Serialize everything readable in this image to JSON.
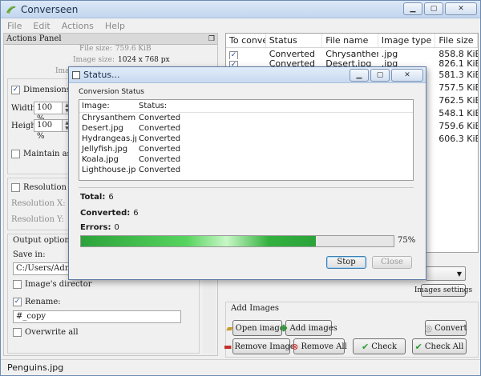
{
  "app": {
    "title": "Converseen",
    "menu": [
      "File",
      "Edit",
      "Actions",
      "Help"
    ]
  },
  "actions_panel": {
    "title": "Actions Panel",
    "file_size_label": "File size:",
    "file_size_value": "759.6 KiB",
    "image_size_label": "Image size:",
    "image_size_value": "1024 x 768 px",
    "image_label": "Image",
    "dimensions_label": "Dimensions",
    "width_label": "Width:",
    "width_value": "100 %",
    "height_label": "Height:",
    "height_value": "100 %",
    "maintain_label": "Maintain aspect",
    "resolution_label": "Resolution",
    "resolution_x_label": "Resolution X:",
    "resolution_y_label": "Resolution Y:",
    "output_label": "Output options",
    "save_in_label": "Save in:",
    "save_in_value": "C:/Users/Adminis",
    "image_directory_label": "Image's director",
    "rename_label": "Rename:",
    "rename_value": "#_copy",
    "overwrite_label": "Overwrite all"
  },
  "table": {
    "headers": [
      "To convert",
      "Status",
      "File name",
      "Image type",
      "File size"
    ],
    "rows": [
      {
        "status": "Converted",
        "name": "Chrysanthemu...",
        "type": ".jpg",
        "size": "858.8 KiB",
        "checked": true
      },
      {
        "status": "Converted",
        "name": "Desert.jpg",
        "type": ".jpg",
        "size": "826.1 KiB",
        "checked": true
      },
      {
        "status": "",
        "name": "",
        "type": "",
        "size": "581.3 KiB",
        "checked": false
      },
      {
        "status": "",
        "name": "",
        "type": "",
        "size": "757.5 KiB",
        "checked": false
      },
      {
        "status": "",
        "name": "",
        "type": "",
        "size": "762.5 KiB",
        "checked": false
      },
      {
        "status": "",
        "name": "",
        "type": "",
        "size": "548.1 KiB",
        "checked": false
      },
      {
        "status": "",
        "name": "",
        "type": "",
        "size": "759.6 KiB",
        "checked": false
      },
      {
        "status": "",
        "name": "",
        "type": "",
        "size": "606.3 KiB",
        "checked": false
      }
    ]
  },
  "lower": {
    "images_settings": "Images settings",
    "add_images_label": "Add Images",
    "open_images": "Open images",
    "add_images": "Add images",
    "convert": "Convert",
    "remove_images": "Remove Images",
    "remove_all": "Remove All",
    "check": "Check",
    "check_all": "Check All"
  },
  "statusbar": {
    "text": "Penguins.jpg"
  },
  "dialog": {
    "title": "Status...",
    "group_label": "Conversion Status",
    "headers": [
      "Image:",
      "Status:"
    ],
    "rows": [
      {
        "image": "Chrysanthemu...",
        "status": "Converted"
      },
      {
        "image": "Desert.jpg",
        "status": "Converted"
      },
      {
        "image": "Hydrangeas.jpg",
        "status": "Converted"
      },
      {
        "image": "Jellyfish.jpg",
        "status": "Converted"
      },
      {
        "image": "Koala.jpg",
        "status": "Converted"
      },
      {
        "image": "Lighthouse.jpg",
        "status": "Converted"
      }
    ],
    "total_label": "Total:",
    "total_value": "6",
    "converted_label": "Converted:",
    "converted_value": "6",
    "errors_label": "Errors:",
    "errors_value": "0",
    "progress": 75,
    "progress_text": "75%",
    "stop": "Stop",
    "close": "Close"
  }
}
